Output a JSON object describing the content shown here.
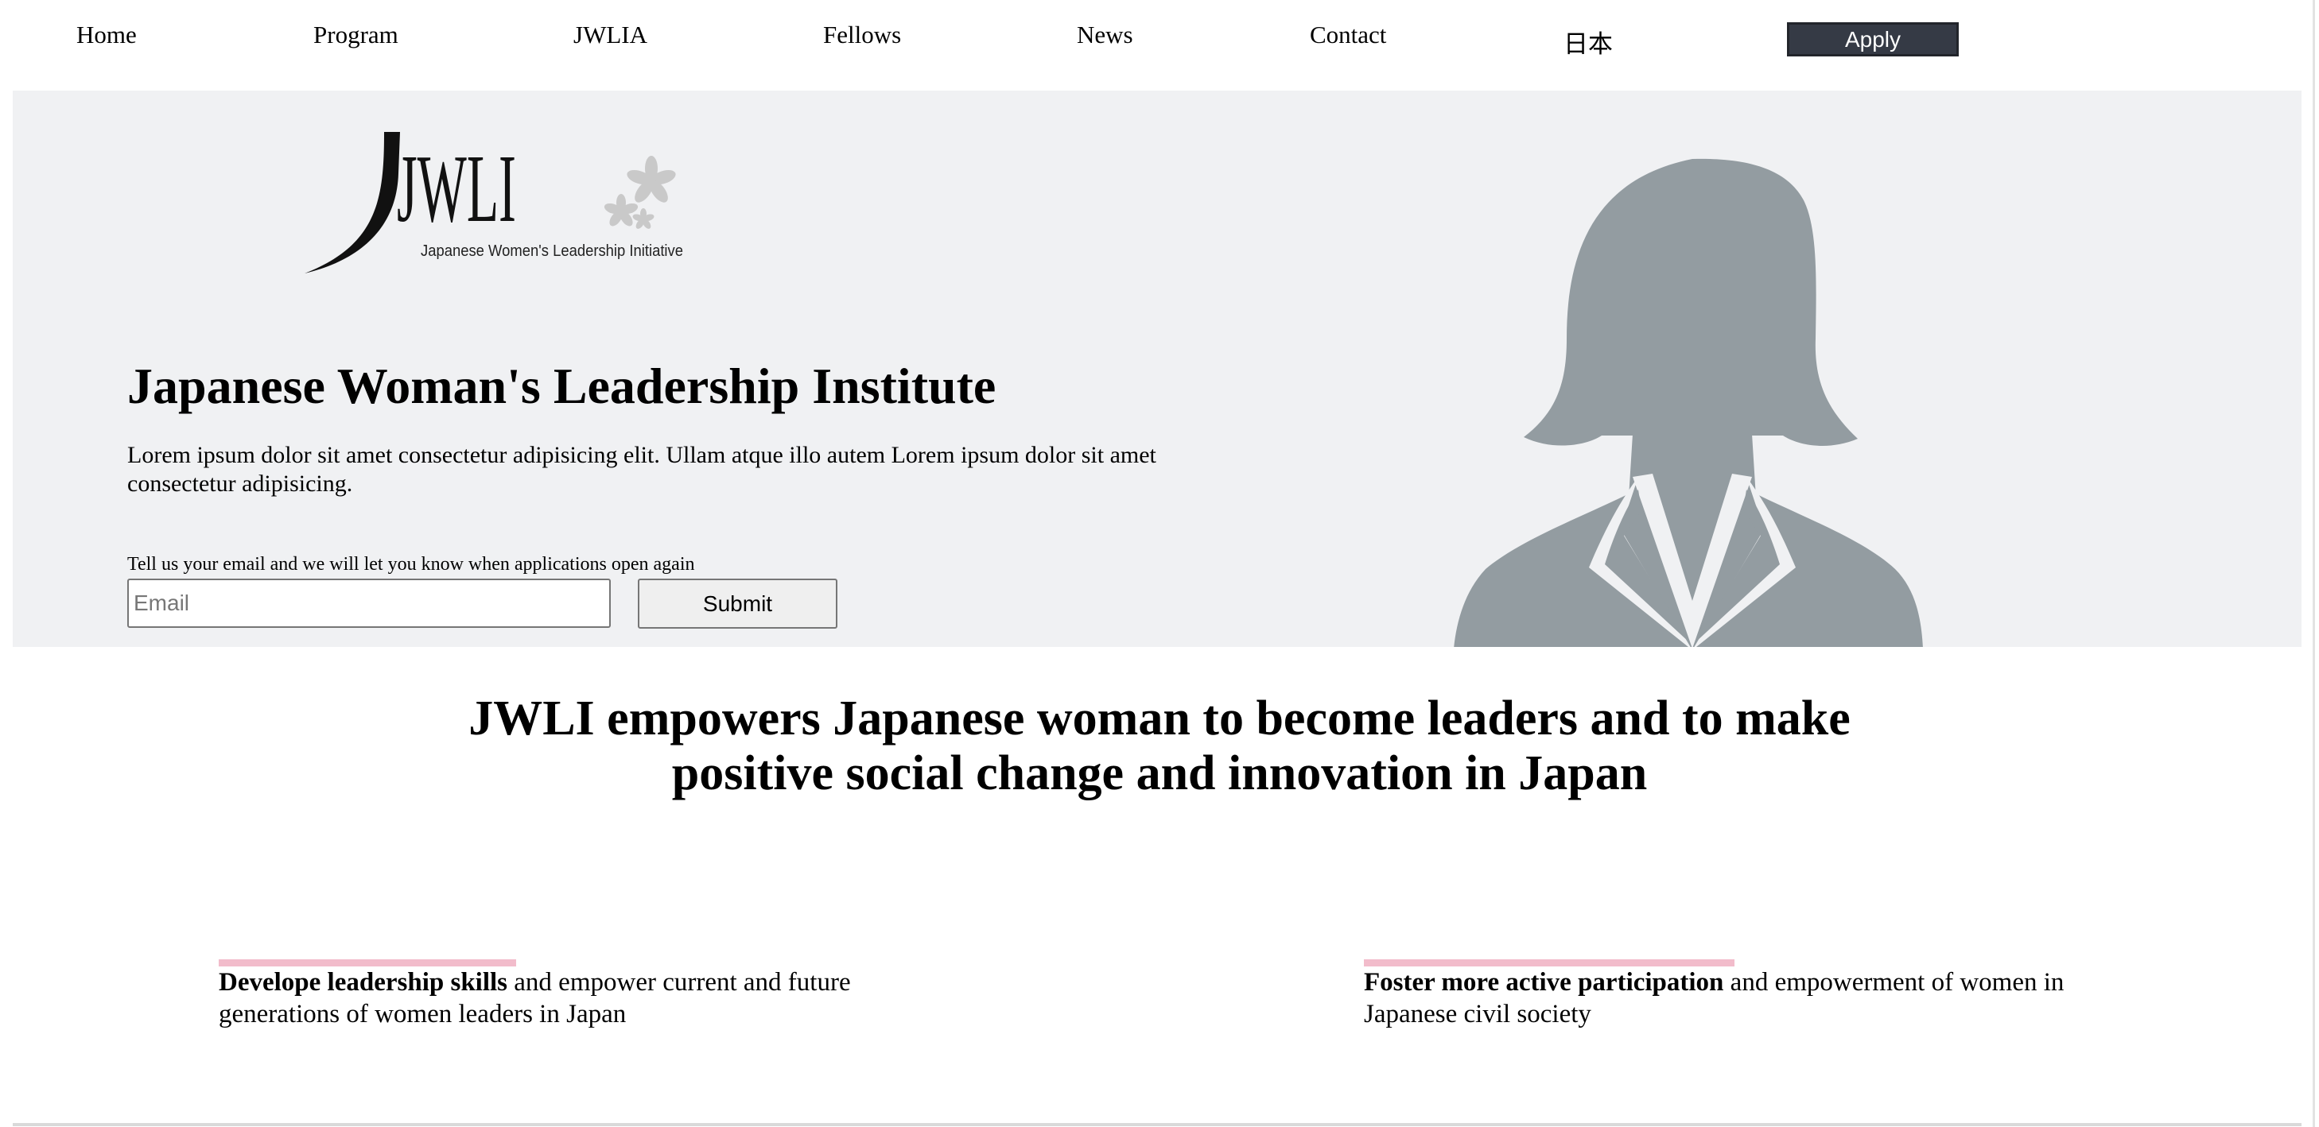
{
  "nav": {
    "items": [
      {
        "label": "Home"
      },
      {
        "label": "Program"
      },
      {
        "label": "JWLIA"
      },
      {
        "label": "Fellows"
      },
      {
        "label": "News"
      },
      {
        "label": "Contact"
      },
      {
        "label": "日本"
      }
    ],
    "apply_label": "Apply"
  },
  "hero": {
    "logo": {
      "wordmark": "JWLI",
      "subtitle": "Japanese Women's Leadership Initiative"
    },
    "title": "Japanese Woman's Leadership Institute",
    "text": "Lorem ipsum dolor sit amet consectetur adipisicing elit. Ullam atque illo autem Lorem ipsum dolor sit amet consectetur adipisicing.",
    "email_label": "Tell us your email and we will let you know when applications open again",
    "email_placeholder": "Email",
    "submit_label": "Submit",
    "avatar_icon": "woman-silhouette-icon"
  },
  "mission": {
    "line1": "JWLI empowers Japanese woman to become leaders and to make",
    "line2": "positive social change and innovation in Japan"
  },
  "goals": [
    {
      "bold": "Develope leadership skills",
      "rest": " and empower current and future generations of women leaders in Japan"
    },
    {
      "bold": "Foster more active participation",
      "rest": " and empowerment of women in Japanese civil society"
    }
  ],
  "colors": {
    "hero_bg": "#f0f1f3",
    "apply_bg": "#353a45",
    "accent_bar": "#f2bccb",
    "silhouette": "#939ca1"
  }
}
